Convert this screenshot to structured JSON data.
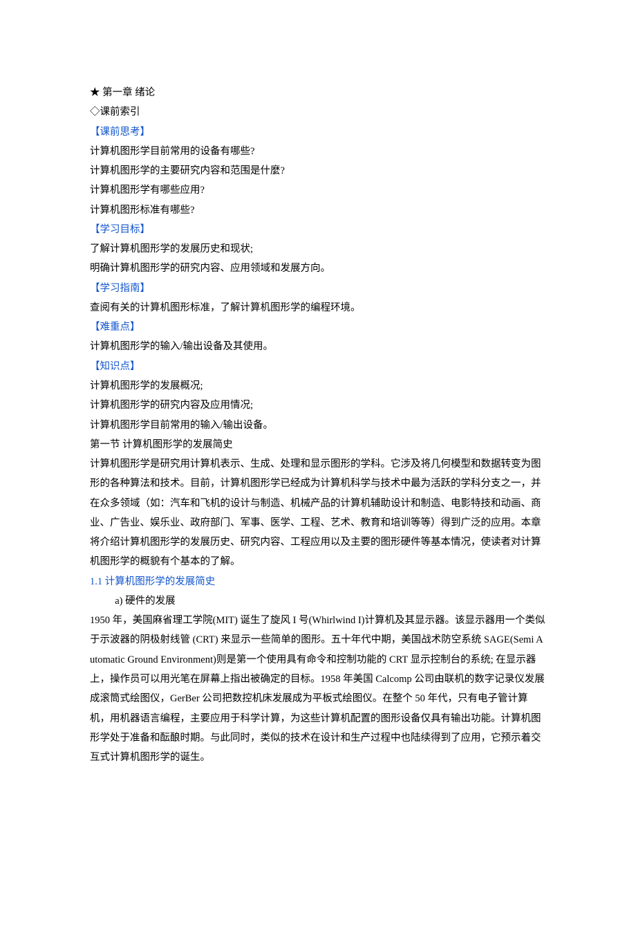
{
  "title": "★  第一章  绪论",
  "pre_index": "◇课前索引",
  "headings": {
    "preclass_think": "【课前思考】",
    "learning_goal": "【学习目标】",
    "learning_guide": "【学习指南】",
    "difficult_points": "【难重点】",
    "knowledge_points": "【知识点】",
    "section1": "1.1 计算机图形学的发展简史"
  },
  "preclass_think": [
    "计算机图形学目前常用的设备有哪些?",
    "计算机图形学的主要研究内容和范围是什麼?",
    "计算机图形学有哪些应用?",
    "计算机图形标准有哪些?"
  ],
  "learning_goal": [
    "了解计算机图形学的发展历史和现状;",
    "明确计算机图形学的研究内容、应用领域和发展方向。"
  ],
  "learning_guide": [
    "查阅有关的计算机图形标准，了解计算机图形学的编程环境。"
  ],
  "difficult_points": [
    "计算机图形学的输入/输出设备及其使用。"
  ],
  "knowledge_points": [
    "计算机图形学的发展概况;",
    "计算机图形学的研究内容及应用情况;",
    "计算机图形学目前常用的输入/输出设备。"
  ],
  "section_intro_title": "第一节    计算机图形学的发展简史",
  "section_intro_body": "计算机图形学是研究用计算机表示、生成、处理和显示图形的学科。它涉及将几何模型和数据转变为图形的各种算法和技术。目前，计算机图形学已经成为计算机科学与技术中最为活跃的学科分支之一，并在众多领域（如：汽车和飞机的设计与制造、机械产品的计算机辅助设计和制造、电影特技和动画、商业、广告业、娱乐业、政府部门、军事、医学、工程、艺术、教育和培训等等）得到广泛的应用。本章将介绍计算机图形学的发展历史、研究内容、工程应用以及主要的图形硬件等基本情况，使读者对计算机图形学的概貌有个基本的了解。",
  "subitem_a": "a)  硬件的发展",
  "body_a": "1950 年，美国麻省理工学院(MIT) 诞生了旋风 I 号(Whirlwind I)计算机及其显示器。该显示器用一个类似于示波器的阴极射线管  (CRT) 来显示一些简单的图形。五十年代中期，美国战术防空系统 SAGE(Semi Automatic Ground Environment)则是第一个使用具有命令和控制功能的 CRT 显示控制台的系统; 在显示器上，操作员可以用光笔在屏幕上指出被确定的目标。1958 年美国 Calcomp 公司由联机的数字记录仪发展成滚筒式绘图仪，GerBer 公司把数控机床发展成为平板式绘图仪。在整个 50 年代，只有电子管计算机，用机器语言编程，主要应用于科学计算，为这些计算机配置的图形设备仅具有输出功能。计算机图形学处于准备和酝酿时期。与此同时，类似的技术在设计和生产过程中也陆续得到了应用，它预示着交互式计算机图形学的诞生。"
}
